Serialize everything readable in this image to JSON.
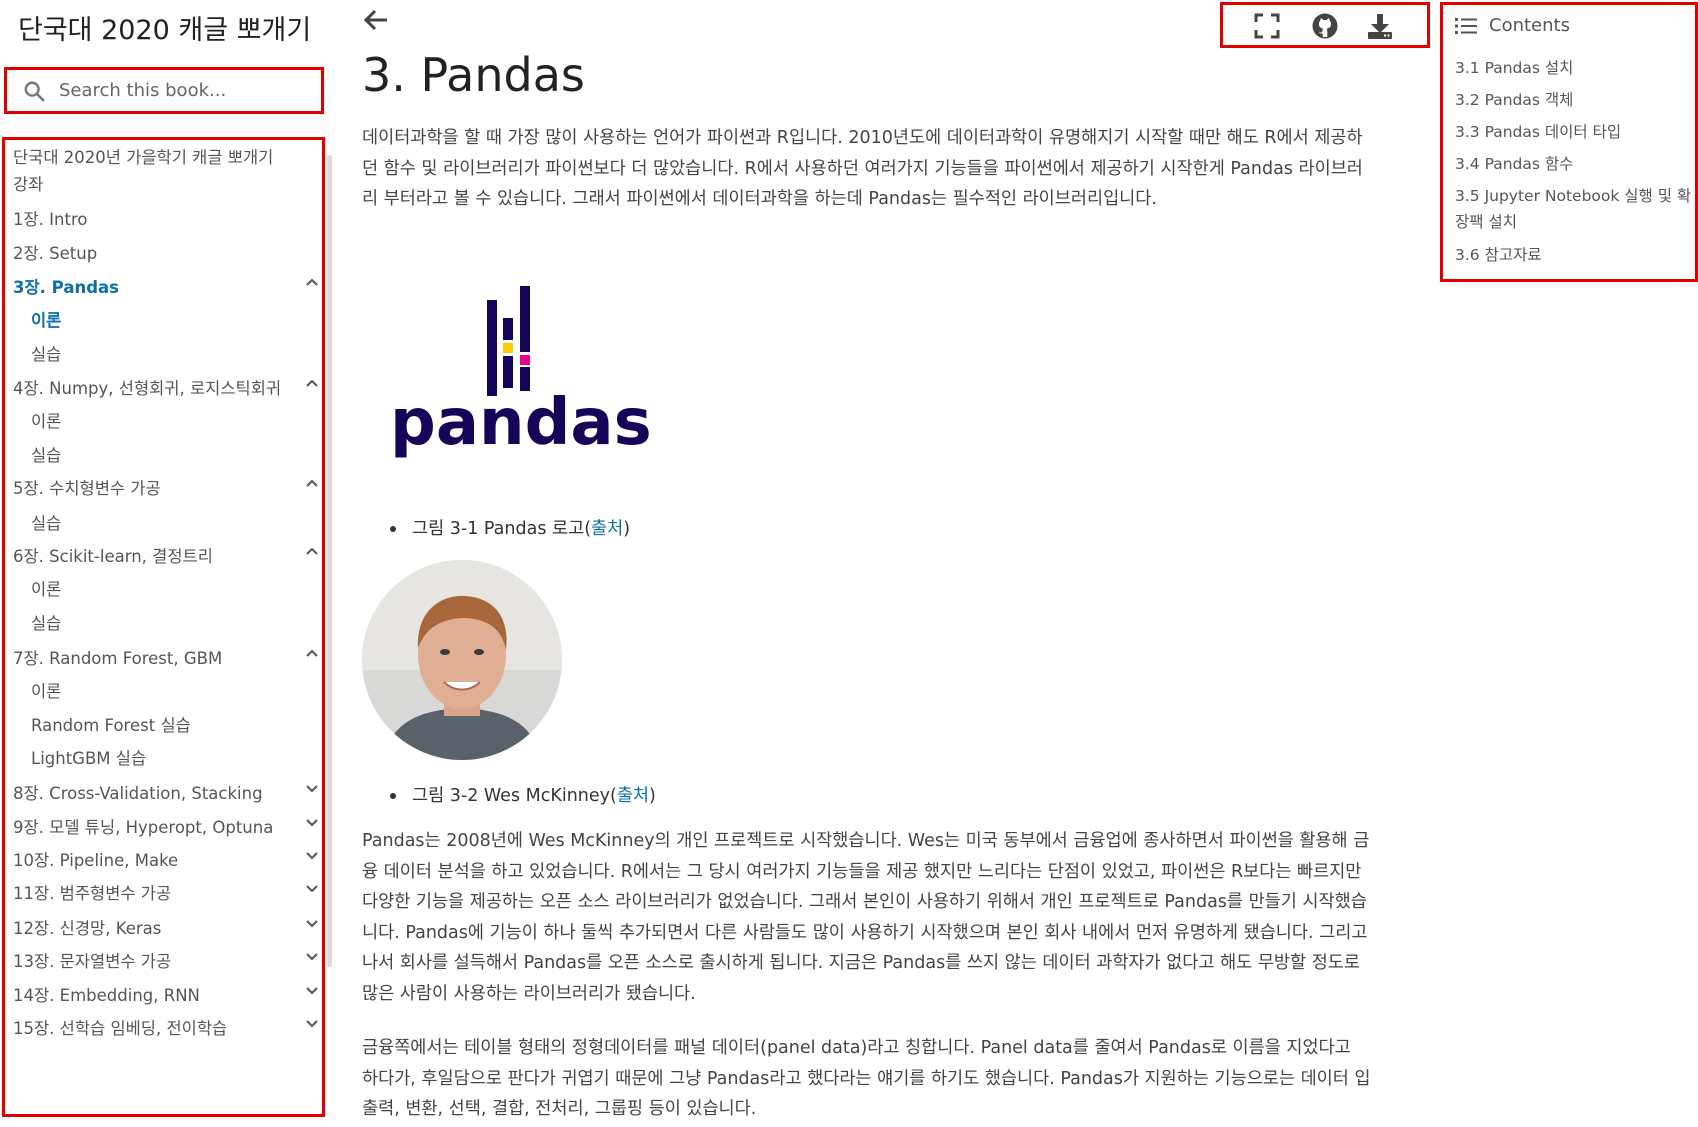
{
  "sidebar": {
    "book_title": "단국대 2020 캐글 뽀개기",
    "search_placeholder": "Search this book...",
    "items": [
      {
        "label": "단국대 2020년 가을학기 캐글 뽀개기 강좌"
      },
      {
        "label": "1장. Intro"
      },
      {
        "label": "2장. Setup"
      },
      {
        "label": "3장. Pandas",
        "active": true,
        "expanded": true
      },
      {
        "label": "이론",
        "active": true
      },
      {
        "label": "실습"
      },
      {
        "label": "4장. Numpy, 선형회귀, 로지스틱회귀",
        "expanded": true
      },
      {
        "label": "이론"
      },
      {
        "label": "실습"
      },
      {
        "label": "5장. 수치형변수 가공",
        "expanded": true
      },
      {
        "label": "실습"
      },
      {
        "label": "6장. Scikit-learn, 결정트리",
        "expanded": true
      },
      {
        "label": "이론"
      },
      {
        "label": "실습"
      },
      {
        "label": "7장. Random Forest, GBM",
        "expanded": true
      },
      {
        "label": "이론"
      },
      {
        "label": "Random Forest 실습"
      },
      {
        "label": "LightGBM 실습"
      },
      {
        "label": "8장. Cross-Validation, Stacking",
        "expanded": false
      },
      {
        "label": "9장. 모델 튜닝, Hyperopt, Optuna",
        "expanded": false
      },
      {
        "label": "10장. Pipeline, Make",
        "expanded": false
      },
      {
        "label": "11장. 범주형변수 가공",
        "expanded": false
      },
      {
        "label": "12장. 신경망, Keras",
        "expanded": false
      },
      {
        "label": "13장. 문자열변수 가공",
        "expanded": false
      },
      {
        "label": "14장. Embedding, RNN",
        "expanded": false
      },
      {
        "label": "15장. 선학습 임베딩, 전이학습",
        "expanded": false
      }
    ]
  },
  "toolbar": {
    "icons": [
      "back-arrow-icon",
      "fullscreen-icon",
      "github-icon",
      "download-icon"
    ]
  },
  "main": {
    "title": "3. Pandas",
    "intro": "데이터과학을 할 때 가장 많이 사용하는 언어가 파이썬과 R입니다. 2010년도에 데이터과학이 유명해지기 시작할 때만 해도 R에서 제공하던 함수 및 라이브러리가 파이썬보다 더 많았습니다. R에서 사용하던 여러가지 기능들을 파이썬에서 제공하기 시작한게 Pandas 라이브러리 부터라고 볼 수 있습니다. 그래서 파이썬에서 데이터과학을 하는데 Pandas는 필수적인 라이브러리입니다.",
    "logo_text": "pandas",
    "figure1_caption": "그림 3-1 Pandas 로고(",
    "figure1_link": "출처",
    "figure2_caption": "그림 3-2 Wes McKinney(",
    "figure2_link": "출처",
    "caption_close": ")",
    "para2": "Pandas는 2008년에 Wes McKinney의 개인 프로젝트로 시작했습니다. Wes는 미국 동부에서 금융업에 종사하면서 파이썬을 활용해 금융 데이터 분석을 하고 있었습니다. R에서는 그 당시 여러가지 기능들을 제공 했지만 느리다는 단점이 있었고, 파이썬은 R보다는 빠르지만 다양한 기능을 제공하는 오픈 소스 라이브러리가 없었습니다. 그래서 본인이 사용하기 위해서 개인 프로젝트로 Pandas를 만들기 시작했습니다. Pandas에 기능이 하나 둘씩 추가되면서 다른 사람들도 많이 사용하기 시작했으며 본인 회사 내에서 먼저 유명하게 됐습니다. 그리고 나서 회사를 설득해서 Pandas를 오픈 소스로 출시하게 됩니다. 지금은 Pandas를 쓰지 않는 데이터 과학자가 없다고 해도 무방할 정도로 많은 사람이 사용하는 라이브러리가 됐습니다.",
    "para3": "금융쪽에서는 테이블 형태의 정형데이터를 패널 데이터(panel data)라고 칭합니다. Panel data를 줄여서 Pandas로 이름을 지었다고 하다가, 후일담으로 판다가 귀엽기 때문에 그냥 Pandas라고 했다라는 얘기를 하기도 했습니다. Pandas가 지원하는 기능으로는 데이터 입출력, 변환, 선택, 결합, 전처리, 그룹핑 등이 있습니다."
  },
  "toc": {
    "heading": "Contents",
    "items": [
      {
        "label": "3.1 Pandas 설치"
      },
      {
        "label": "3.2 Pandas 객체"
      },
      {
        "label": "3.3 Pandas 데이터 타입"
      },
      {
        "label": "3.4 Pandas 함수"
      },
      {
        "label": "3.5 Jupyter Notebook 실행 및 확장팩 설치"
      },
      {
        "label": "3.6 참고자료"
      }
    ]
  },
  "colors": {
    "accent": "#0b6fa9",
    "highlight_box": "#e00000",
    "pandas_navy": "#150458",
    "pandas_yellow": "#ffca00",
    "pandas_pink": "#e70488"
  }
}
